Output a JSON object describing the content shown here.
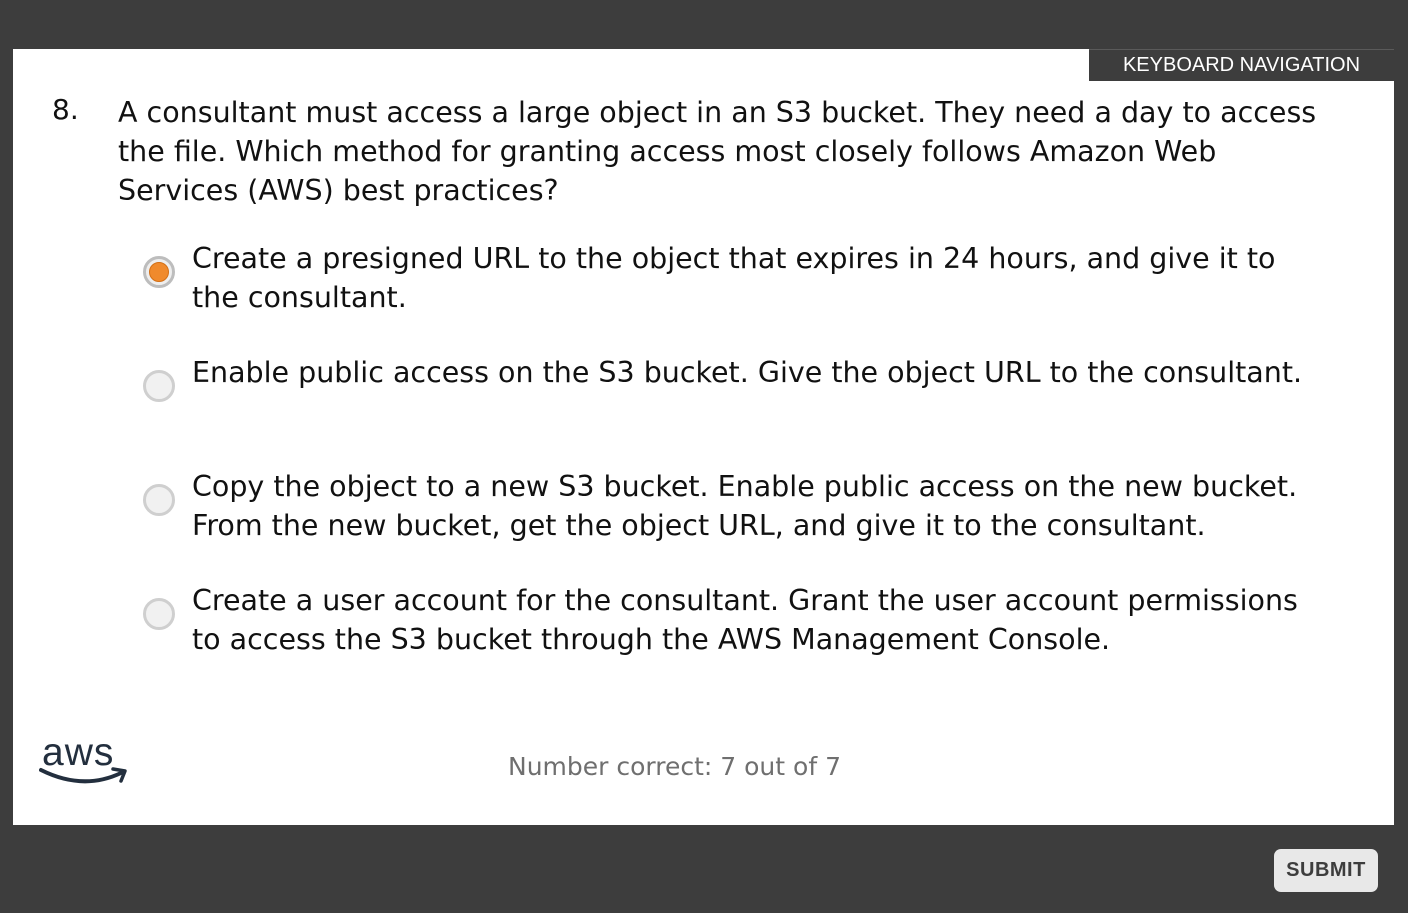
{
  "header": {
    "keyboard_nav_label": "KEYBOARD NAVIGATION"
  },
  "question": {
    "number": "8.",
    "text": "A consultant must access a large object in an S3 bucket. They need a day to access the file. Which method for granting access most closely follows Amazon Web Services (AWS) best practices?"
  },
  "options": [
    {
      "text": "Create a presigned URL to the object that expires in 24 hours, and give it to the consultant.",
      "selected": true
    },
    {
      "text": "Enable public access on the S3 bucket. Give the object URL to the consultant.",
      "selected": false
    },
    {
      "text": "Copy the object to a new S3 bucket. Enable public access on the new bucket. From the new bucket, get the object URL, and give it to the consultant.",
      "selected": false
    },
    {
      "text": "Create a user account for the consultant. Grant the user account permissions to access the S3 bucket through the AWS Management Console.",
      "selected": false
    }
  ],
  "footer": {
    "logo_text": "aws",
    "score_text": "Number correct: 7 out of 7",
    "submit_label": "SUBMIT"
  },
  "colors": {
    "frame": "#3d3d3d",
    "panel": "#ffffff",
    "selected_radio": "#f08a2c",
    "score_text": "#6f6f6f"
  }
}
